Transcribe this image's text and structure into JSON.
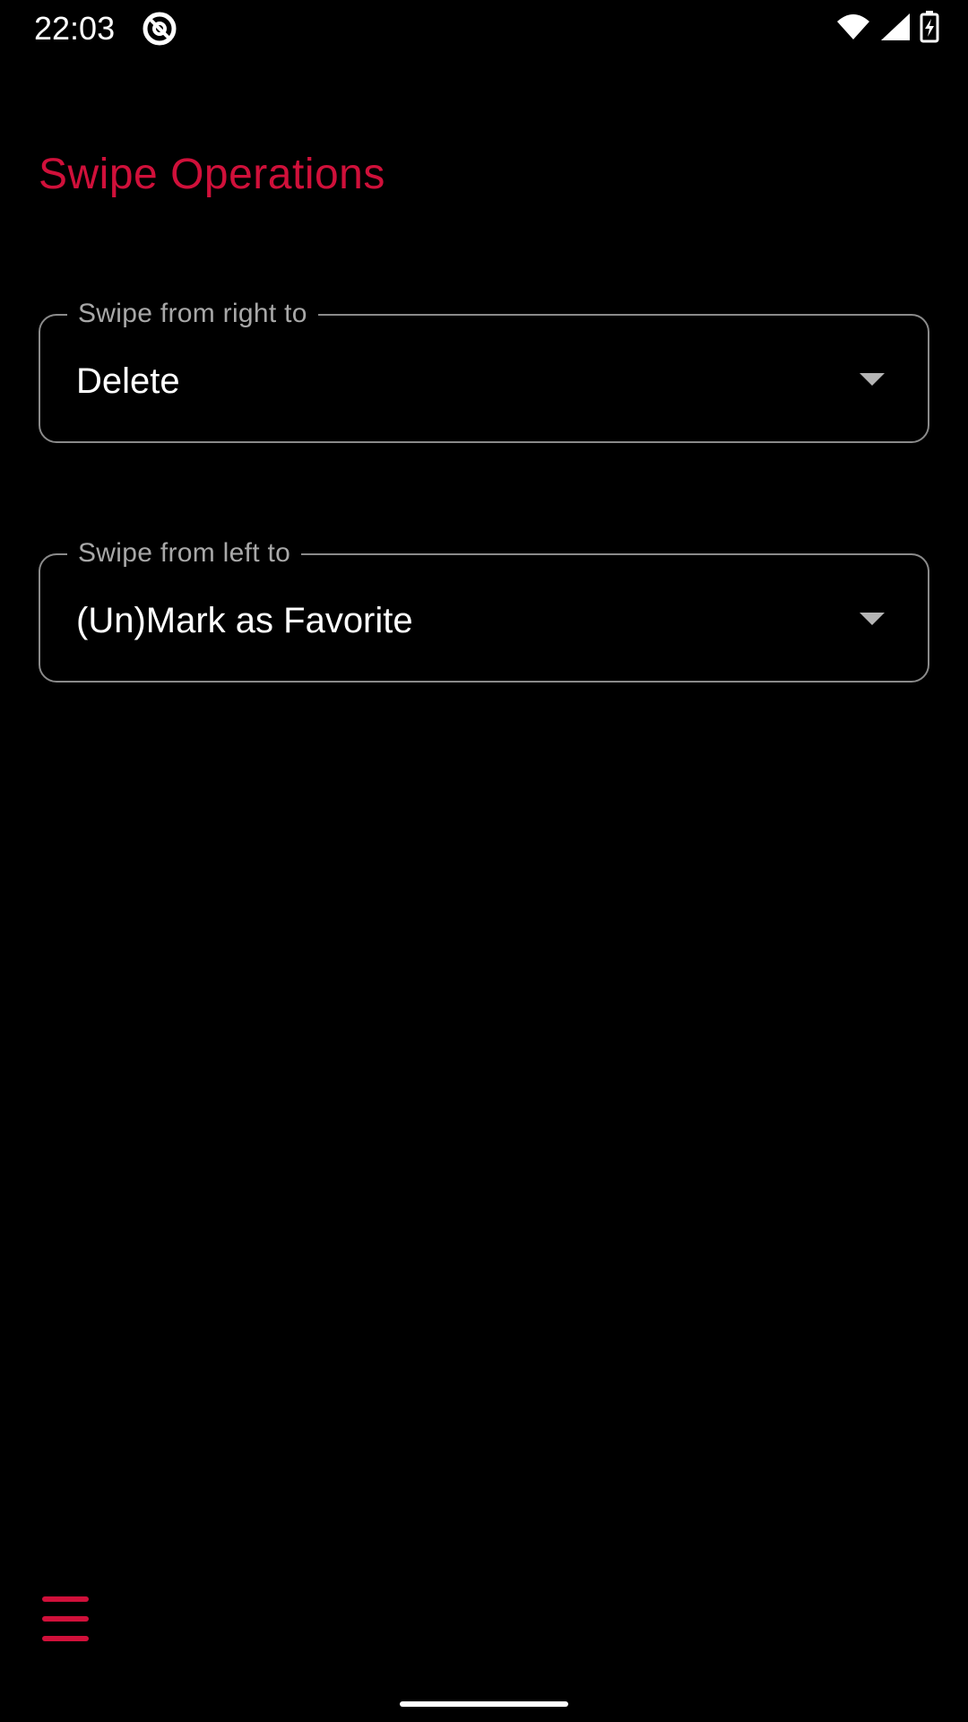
{
  "status_bar": {
    "time": "22:03",
    "app_icon": "at-sign-icon",
    "wifi_icon": "wifi-icon",
    "signal_icon": "cellular-signal-icon",
    "battery_icon": "battery-charging-icon"
  },
  "page": {
    "title": "Swipe Operations",
    "accent_color": "#D0103A"
  },
  "fields": [
    {
      "label": "Swipe from right to",
      "value": "Delete"
    },
    {
      "label": "Swipe from left to",
      "value": "(Un)Mark as Favorite"
    }
  ],
  "bottom": {
    "menu_icon": "hamburger-menu-icon"
  }
}
